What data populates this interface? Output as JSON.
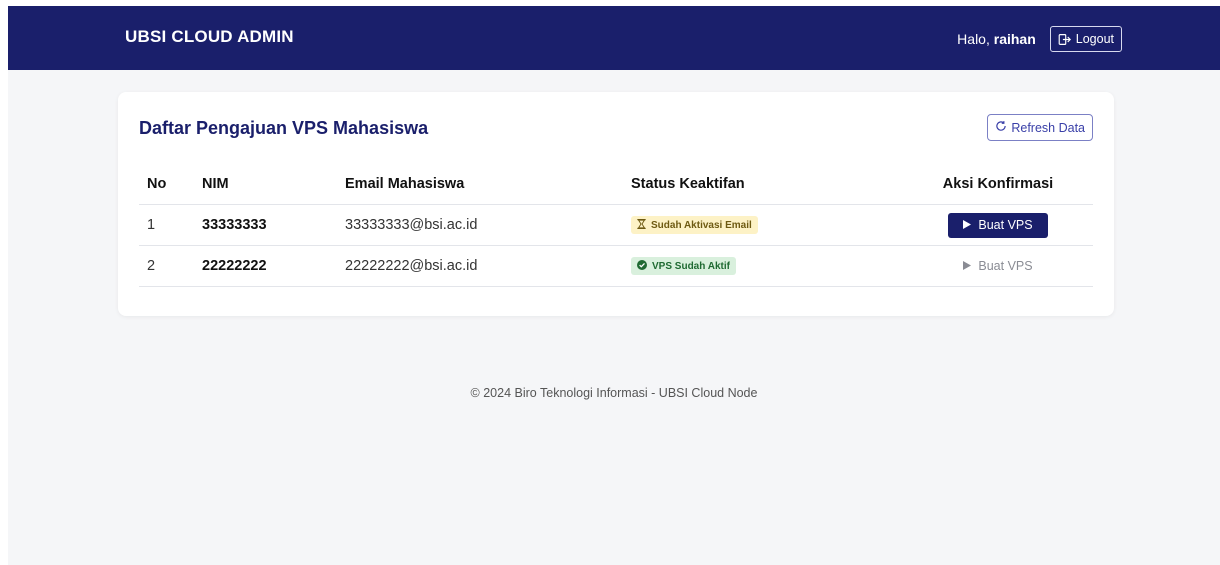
{
  "navbar": {
    "brand": "UBSI CLOUD ADMIN",
    "greeting_prefix": "Halo, ",
    "username": "raihan",
    "logout_label": "Logout",
    "logout_icon": "logout-icon"
  },
  "card": {
    "title": "Daftar Pengajuan VPS Mahasiswa",
    "refresh_label": "Refresh Data",
    "refresh_icon": "refresh-icon"
  },
  "table": {
    "headers": {
      "no": "No",
      "nim": "NIM",
      "email": "Email Mahasiswa",
      "status": "Status Keaktifan",
      "aksi": "Aksi Konfirmasi"
    },
    "rows": [
      {
        "no": "1",
        "nim": "33333333",
        "email": "33333333@bsi.ac.id",
        "status": "Sudah Aktivasi Email",
        "status_icon": "hourglass-icon",
        "action": "Buat VPS",
        "action_enabled": true
      },
      {
        "no": "2",
        "nim": "22222222",
        "email": "22222222@bsi.ac.id",
        "status": "VPS Sudah Aktif",
        "status_icon": "check-circle-icon",
        "action": "Buat VPS",
        "action_enabled": false
      }
    ]
  },
  "footer": {
    "text": "© 2024 Biro Teknologi Informasi - UBSI Cloud Node"
  },
  "colors": {
    "navbar": "#1a1f6b",
    "primary_button": "#1a1f6b",
    "badge_warning_bg": "#fdf2c6",
    "badge_success_bg": "#d9f0dd",
    "page_bg": "#f5f6f8"
  }
}
